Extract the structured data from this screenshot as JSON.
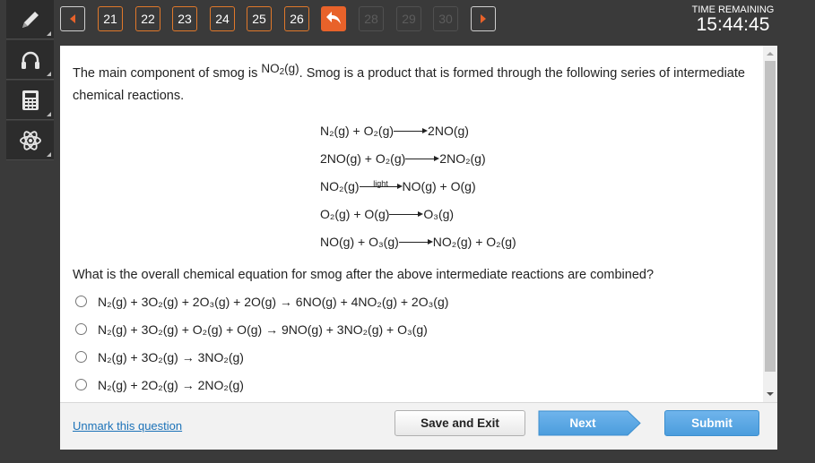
{
  "tools": [
    {
      "icon": "pencil-icon"
    },
    {
      "icon": "headphones-icon"
    },
    {
      "icon": "calculator-icon"
    },
    {
      "icon": "atom-icon"
    }
  ],
  "nav": {
    "prev_icon": "chevron-left-icon",
    "numbers": [
      {
        "label": "21",
        "state": "active"
      },
      {
        "label": "22",
        "state": "active"
      },
      {
        "label": "23",
        "state": "active"
      },
      {
        "label": "24",
        "state": "active"
      },
      {
        "label": "25",
        "state": "active"
      },
      {
        "label": "26",
        "state": "active"
      }
    ],
    "back_icon": "return-arrow-icon",
    "disabled": [
      "28",
      "29",
      "30"
    ],
    "next_icon": "chevron-right-icon",
    "accent_color": "#e8622a"
  },
  "timer": {
    "label": "TIME REMAINING",
    "value": "15:44:45"
  },
  "question": {
    "intro_a": "The main component of smog is ",
    "intro_formula_main": "NO",
    "intro_formula_sub": "2",
    "intro_formula_end": "(g)",
    "intro_b": ". Smog is a product that is formed through the following series of intermediate chemical reactions.",
    "reactions": [
      {
        "left": [
          [
            "N",
            "2"
          ],
          [
            "(g) + O",
            ""
          ],
          [
            "2",
            ""
          ]
        ],
        "text_left": "N₂(g) + O₂(g)",
        "arrow_label": "",
        "text_right": "2NO(g)"
      },
      {
        "text_left": "2NO(g) + O₂(g)",
        "arrow_label": "",
        "text_right": "2NO₂(g)"
      },
      {
        "text_left": "NO₂(g)",
        "arrow_label": "light",
        "text_right": "NO(g) + O(g)"
      },
      {
        "text_left": "O₂(g) + O(g)",
        "arrow_label": "",
        "text_right": "O₃(g)"
      },
      {
        "text_left": "NO(g) + O₃(g)",
        "arrow_label": "",
        "text_right": "NO₂(g) + O₂(g)"
      }
    ],
    "prompt": "What is the overall chemical equation for smog after the above intermediate reactions are combined?",
    "options": [
      "N₂(g) + 3O₂(g) + 2O₃(g) + 2O(g) → 6NO(g) + 4NO₂(g) + 2O₃(g)",
      "N₂(g) + 3O₂(g) + O₂(g) + O(g) → 9NO(g) + 3NO₂(g) + O₃(g)",
      "N₂(g) + 3O₂(g) → 3NO₂(g)",
      "N₂(g) + 2O₂(g) → 2NO₂(g)"
    ]
  },
  "footer": {
    "unmark": "Unmark this question",
    "save_exit": "Save and Exit",
    "next": "Next",
    "submit": "Submit"
  }
}
